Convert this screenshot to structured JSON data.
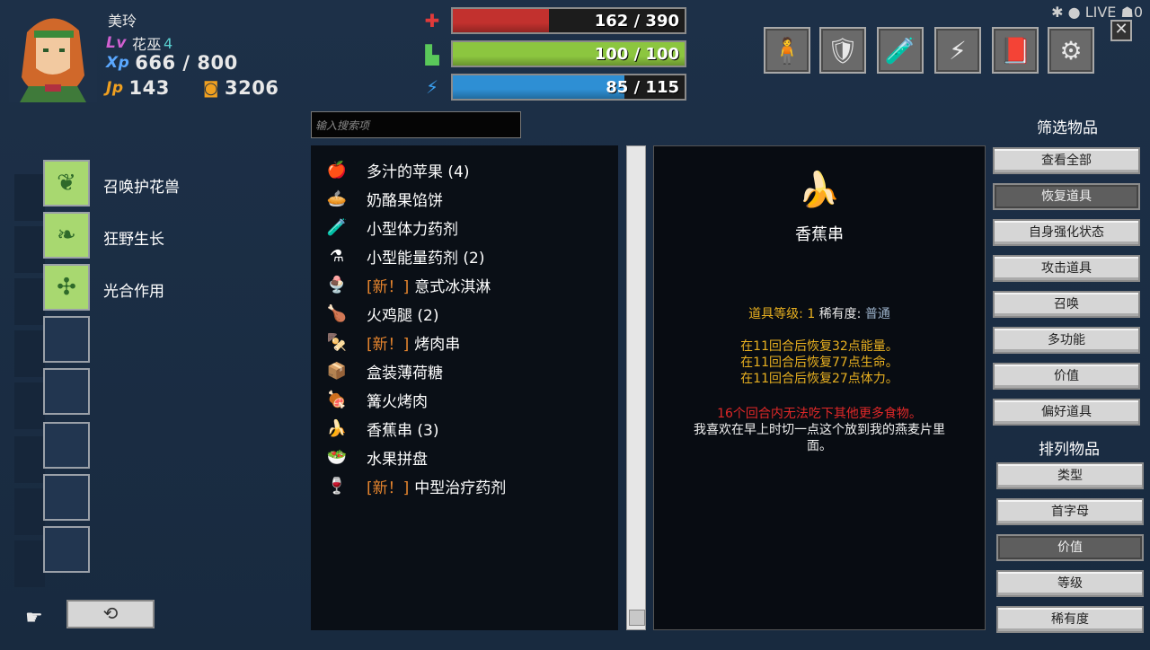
{
  "character": {
    "name": "美玲",
    "lv_label": "Lv",
    "class_name": "花巫",
    "level": "4",
    "xp_label": "Xp",
    "xp": "666 / 800",
    "jp_label": "Jp",
    "jp": "143",
    "gold": "3206"
  },
  "bars": {
    "hp": {
      "text": "162 / 390",
      "fraction": 0.415,
      "color": "#c2312e"
    },
    "stamina": {
      "text": "100 / 100",
      "fraction": 1.0,
      "color": "#8cc63f"
    },
    "energy": {
      "text": "85 / 115",
      "fraction": 0.739,
      "color": "#2e8fd4"
    }
  },
  "top_menu": [
    {
      "name": "character-icon",
      "glyph": "🧍"
    },
    {
      "name": "shield-icon",
      "glyph": "🛡"
    },
    {
      "name": "potion-icon",
      "glyph": "🧪"
    },
    {
      "name": "skills-icon",
      "glyph": "⚡"
    },
    {
      "name": "book-icon",
      "glyph": "📕"
    },
    {
      "name": "settings-gear-icon",
      "glyph": "⚙"
    }
  ],
  "live_label": "LIVE",
  "live_count": "0",
  "skills": [
    {
      "label": "召唤护花兽"
    },
    {
      "label": "狂野生长"
    },
    {
      "label": "光合作用"
    }
  ],
  "search": {
    "placeholder": "输入搜索项"
  },
  "items": [
    {
      "icon": "🍎",
      "new": "",
      "name": "多汁的苹果 (4)"
    },
    {
      "icon": "🥧",
      "new": "",
      "name": "奶酪果馅饼"
    },
    {
      "icon": "🧪",
      "new": "",
      "name": "小型体力药剂"
    },
    {
      "icon": "⚗",
      "new": "",
      "name": "小型能量药剂 (2)"
    },
    {
      "icon": "🍨",
      "new": "[新！]",
      "name": "意式冰淇淋"
    },
    {
      "icon": "🍗",
      "new": "",
      "name": "火鸡腿 (2)"
    },
    {
      "icon": "🍢",
      "new": "[新！]",
      "name": "烤肉串"
    },
    {
      "icon": "📦",
      "new": "",
      "name": "盒装薄荷糖"
    },
    {
      "icon": "🍖",
      "new": "",
      "name": "篝火烤肉"
    },
    {
      "icon": "🍌",
      "new": "",
      "name": "香蕉串 (3)"
    },
    {
      "icon": "🥗",
      "new": "",
      "name": "水果拼盘"
    },
    {
      "icon": "🍷",
      "new": "[新！]",
      "name": "中型治疗药剂"
    }
  ],
  "detail": {
    "icon": "🍌",
    "title": "香蕉串",
    "grade_label": "道具等级:",
    "grade": "1",
    "rarity_label": "稀有度:",
    "rarity": "普通",
    "effects": [
      "在11回合后恢复32点能量。",
      "在11回合后恢复77点生命。",
      "在11回合后恢复27点体力。"
    ],
    "warning": "16个回合内无法吃下其他更多食物。",
    "flavor_1": "我喜欢在早上时切一点这个放到我的燕麦片里",
    "flavor_2": "面。"
  },
  "filter": {
    "heading": "筛选物品",
    "buttons": [
      "查看全部",
      "恢复道具",
      "自身强化状态",
      "攻击道具",
      "召唤",
      "多功能",
      "价值",
      "偏好道具"
    ],
    "active": 1
  },
  "sort": {
    "heading": "排列物品",
    "buttons": [
      "类型",
      "首字母",
      "价值",
      "等级",
      "稀有度"
    ],
    "active": 2
  },
  "swap_glyph": "⟲"
}
